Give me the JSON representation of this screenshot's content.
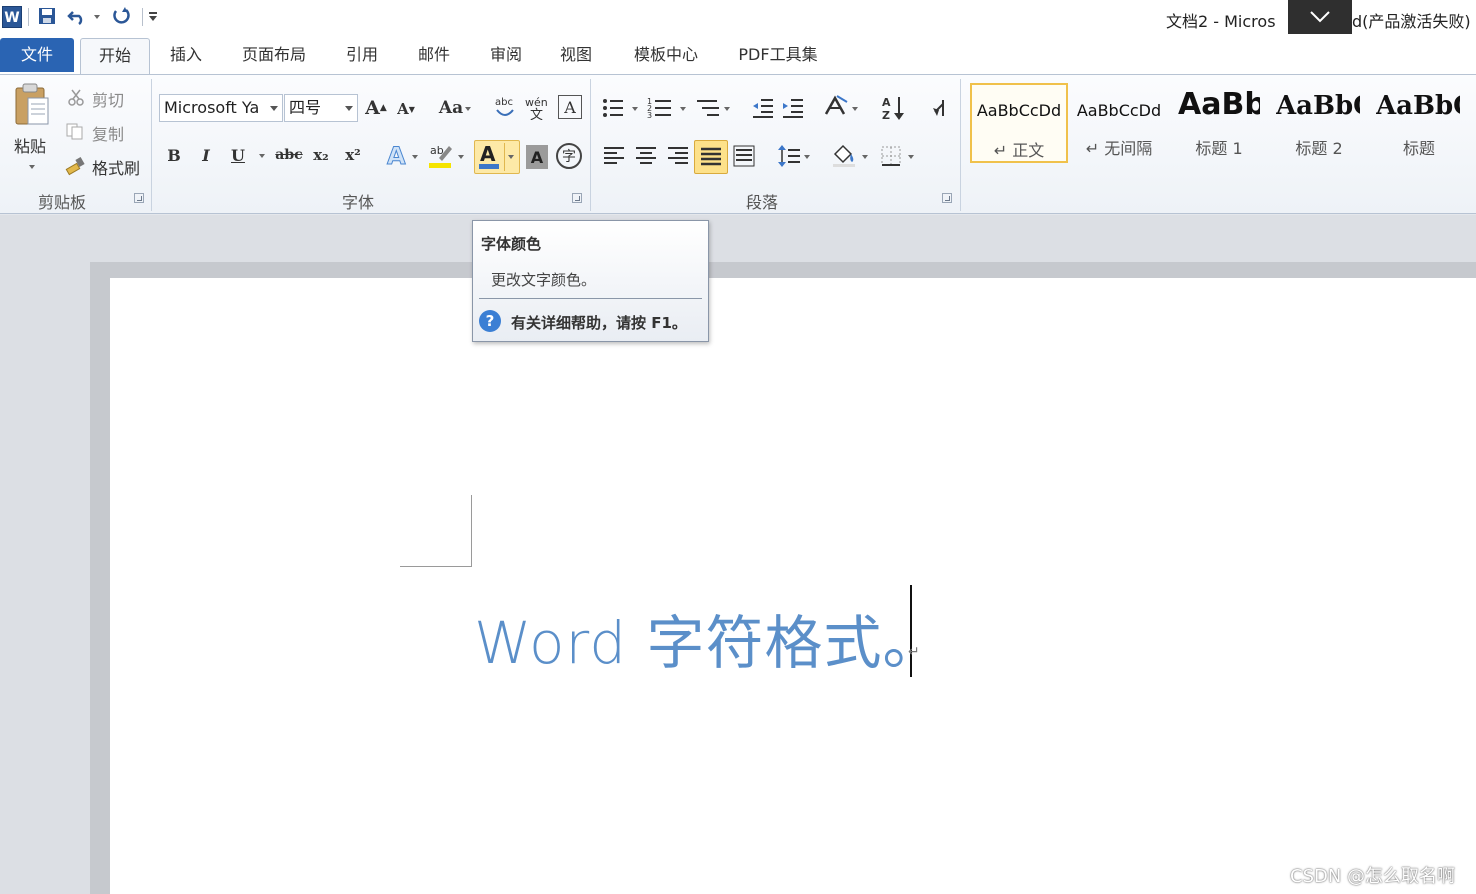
{
  "window": {
    "title_left": "文档2 - Micros",
    "title_right": "d(产品激活失败)"
  },
  "qat": {
    "app_icon": "W",
    "save": "save-icon",
    "undo": "undo-icon",
    "redo": "redo-icon",
    "customize": "dropdown-icon"
  },
  "tabs": {
    "file": "文件",
    "items": [
      "开始",
      "插入",
      "页面布局",
      "引用",
      "邮件",
      "审阅",
      "视图",
      "模板中心",
      "PDF工具集"
    ]
  },
  "clipboard": {
    "paste": "粘贴",
    "cut": "剪切",
    "copy": "复制",
    "format_painter": "格式刷",
    "label": "剪贴板"
  },
  "font": {
    "name": "Microsoft Ya",
    "size": "四号",
    "grow": "A",
    "shrink": "A",
    "change_case": "Aa",
    "bold": "B",
    "italic": "I",
    "underline": "U",
    "strikethrough": "abc",
    "subscript": "x₂",
    "superscript": "x²",
    "font_color_glyph": "A",
    "char_shading_glyph": "A",
    "enclose_glyph": "字",
    "label": "字体"
  },
  "paragraph": {
    "label": "段落"
  },
  "styles": [
    {
      "sample": "AaBbCcDd",
      "name": "↵ 正文"
    },
    {
      "sample": "AaBbCcDd",
      "name": "↵ 无间隔"
    },
    {
      "sample": "AaBb",
      "name": "标题 1"
    },
    {
      "sample": "AaBbC",
      "name": "标题 2"
    },
    {
      "sample": "AaBbC",
      "name": "标题"
    }
  ],
  "tooltip": {
    "title": "字体颜色",
    "description": "更改文字颜色。",
    "help": "有关详细帮助，请按 F1。"
  },
  "document": {
    "text": "Word 字符格式。",
    "paragraph_mark": "↵"
  },
  "watermark": "CSDN @怎么取名啊",
  "colors": {
    "file_tab": "#2a64b3",
    "doc_text": "#5b8fc9",
    "highlight": "#fde9a7"
  }
}
